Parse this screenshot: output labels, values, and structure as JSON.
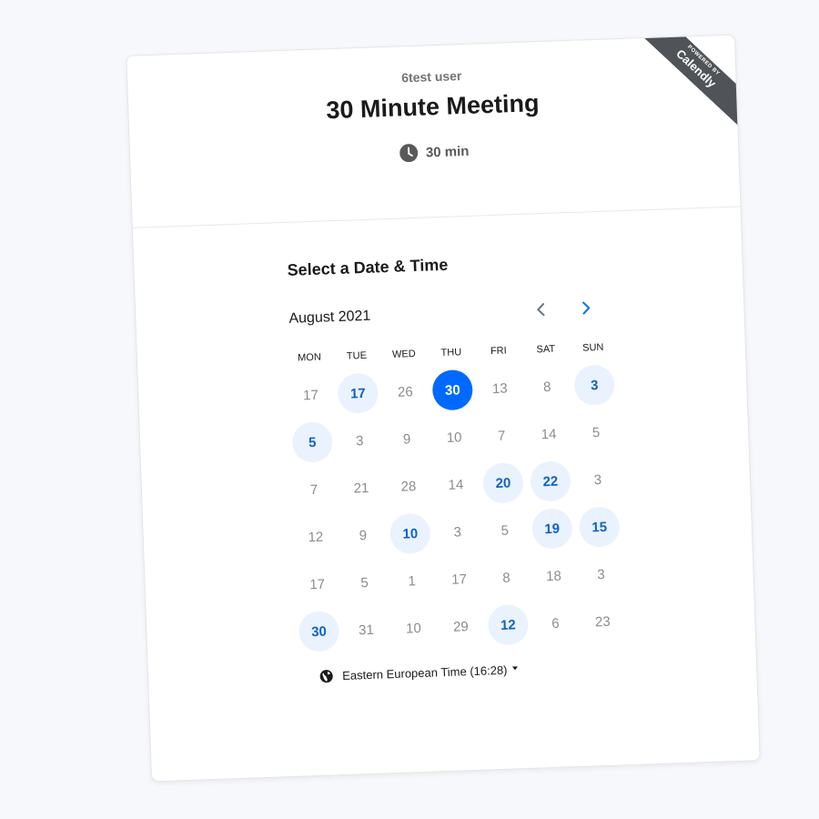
{
  "header": {
    "owner_name": "6test user",
    "event_title": "30 Minute Meeting",
    "duration": "30 min",
    "ribbon": {
      "top_text": "POWERED BY",
      "brand": "Calendly"
    }
  },
  "scheduler": {
    "section_title": "Select a Date & Time",
    "month_label": "August 2021",
    "weekdays": [
      "MON",
      "TUE",
      "WED",
      "THU",
      "FRI",
      "SAT",
      "SUN"
    ],
    "days": [
      {
        "label": "17",
        "state": "unavailable"
      },
      {
        "label": "17",
        "state": "available"
      },
      {
        "label": "26",
        "state": "unavailable"
      },
      {
        "label": "30",
        "state": "selected"
      },
      {
        "label": "13",
        "state": "unavailable"
      },
      {
        "label": "8",
        "state": "unavailable"
      },
      {
        "label": "3",
        "state": "available"
      },
      {
        "label": "5",
        "state": "available"
      },
      {
        "label": "3",
        "state": "unavailable"
      },
      {
        "label": "9",
        "state": "unavailable"
      },
      {
        "label": "10",
        "state": "unavailable"
      },
      {
        "label": "7",
        "state": "unavailable"
      },
      {
        "label": "14",
        "state": "unavailable"
      },
      {
        "label": "5",
        "state": "unavailable"
      },
      {
        "label": "7",
        "state": "unavailable"
      },
      {
        "label": "21",
        "state": "unavailable"
      },
      {
        "label": "28",
        "state": "unavailable"
      },
      {
        "label": "14",
        "state": "unavailable"
      },
      {
        "label": "20",
        "state": "available"
      },
      {
        "label": "22",
        "state": "available"
      },
      {
        "label": "3",
        "state": "unavailable"
      },
      {
        "label": "12",
        "state": "unavailable"
      },
      {
        "label": "9",
        "state": "unavailable"
      },
      {
        "label": "10",
        "state": "available"
      },
      {
        "label": "3",
        "state": "unavailable"
      },
      {
        "label": "5",
        "state": "unavailable"
      },
      {
        "label": "19",
        "state": "available"
      },
      {
        "label": "15",
        "state": "available"
      },
      {
        "label": "17",
        "state": "unavailable"
      },
      {
        "label": "5",
        "state": "unavailable"
      },
      {
        "label": "1",
        "state": "unavailable"
      },
      {
        "label": "17",
        "state": "unavailable"
      },
      {
        "label": "8",
        "state": "unavailable"
      },
      {
        "label": "18",
        "state": "unavailable"
      },
      {
        "label": "3",
        "state": "unavailable"
      },
      {
        "label": "30",
        "state": "available"
      },
      {
        "label": "31",
        "state": "unavailable"
      },
      {
        "label": "10",
        "state": "unavailable"
      },
      {
        "label": "29",
        "state": "unavailable"
      },
      {
        "label": "12",
        "state": "available"
      },
      {
        "label": "6",
        "state": "unavailable"
      },
      {
        "label": "23",
        "state": "unavailable"
      }
    ],
    "timezone_label": "Eastern European Time (16:28)"
  },
  "icons": {
    "clock": "clock-icon",
    "prev": "chevron-left-icon",
    "next": "chevron-right-icon",
    "globe": "globe-icon",
    "caret": "caret-down-icon"
  },
  "colors": {
    "accent": "#0069ff",
    "available_bg": "#eaf2fe",
    "available_text": "#0f62c6",
    "ribbon_bg": "#505357"
  }
}
